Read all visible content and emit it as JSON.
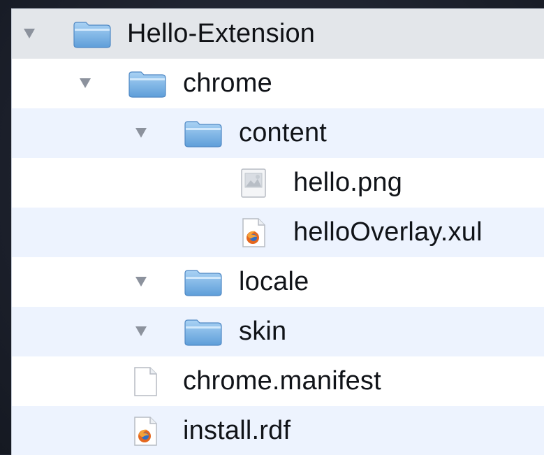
{
  "tree": [
    {
      "name": "Hello-Extension",
      "kind": "folder",
      "expanded": true,
      "depth": 0,
      "icon": "folder-icon",
      "row_background": "#e3e6ea"
    },
    {
      "name": "chrome",
      "kind": "folder",
      "expanded": true,
      "depth": 1,
      "icon": "folder-icon",
      "row_background": "#ffffff"
    },
    {
      "name": "content",
      "kind": "folder",
      "expanded": true,
      "depth": 2,
      "icon": "folder-icon",
      "row_background": "#edf3fe"
    },
    {
      "name": "hello.png",
      "kind": "file",
      "expanded": false,
      "depth": 3,
      "icon": "image-file-icon",
      "row_background": "#ffffff"
    },
    {
      "name": "helloOverlay.xul",
      "kind": "file",
      "expanded": false,
      "depth": 3,
      "icon": "firefox-file-icon",
      "row_background": "#edf3fe"
    },
    {
      "name": "locale",
      "kind": "folder",
      "expanded": true,
      "depth": 2,
      "icon": "folder-icon",
      "row_background": "#ffffff"
    },
    {
      "name": "skin",
      "kind": "folder",
      "expanded": true,
      "depth": 2,
      "icon": "folder-icon",
      "row_background": "#edf3fe"
    },
    {
      "name": "chrome.manifest",
      "kind": "file",
      "expanded": false,
      "depth": 1,
      "icon": "document-file-icon",
      "row_background": "#ffffff"
    },
    {
      "name": "install.rdf",
      "kind": "file",
      "expanded": false,
      "depth": 1,
      "icon": "firefox-file-icon",
      "row_background": "#edf3fe"
    }
  ],
  "colors": {
    "backdrop": "#1f2432",
    "folder_top": "#9fcaf0",
    "folder_bottom": "#5e9ed9",
    "disclosure_triangle": "#8c929d",
    "text": "#101318"
  }
}
